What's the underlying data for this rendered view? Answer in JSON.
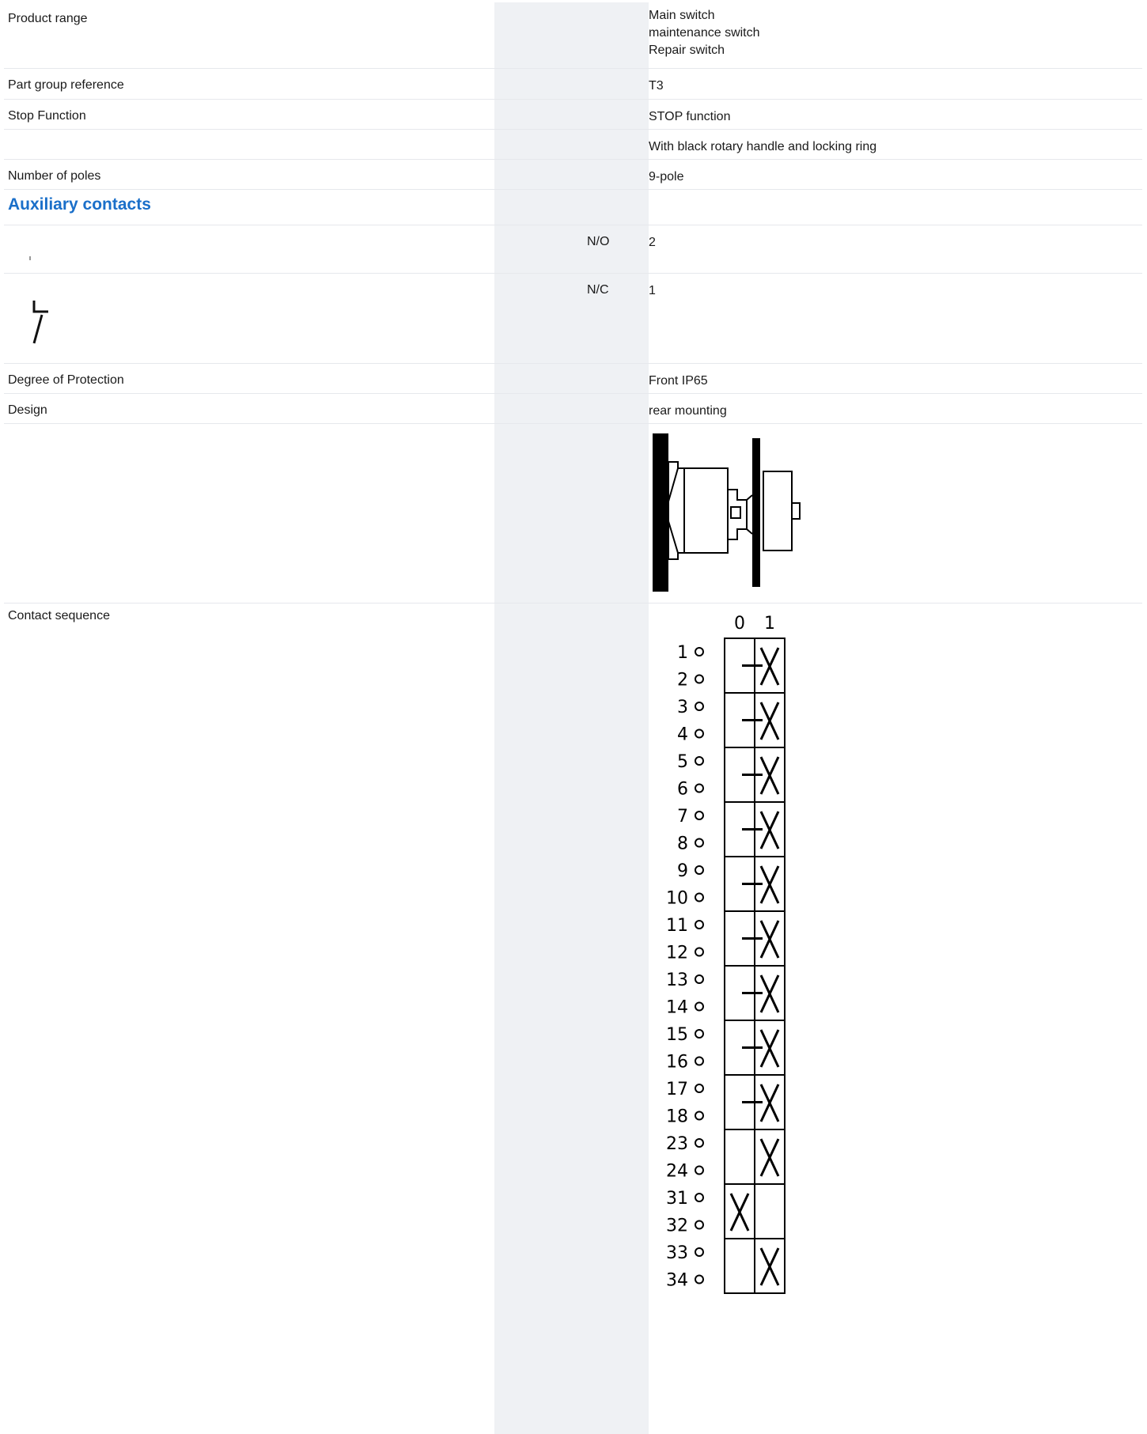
{
  "rows": [
    {
      "label": "Product range",
      "value": "Main switch\nmaintenance switch\nRepair switch"
    },
    {
      "label": "Part group reference",
      "value": "T3"
    },
    {
      "label": "Stop Function",
      "value": "STOP function"
    },
    {
      "label": "",
      "value": "With black rotary handle and locking ring"
    },
    {
      "label": "Number of poles",
      "value": "9-pole"
    }
  ],
  "section_title": "Auxiliary contacts",
  "aux": [
    {
      "unit": "N/O",
      "value": "2",
      "icon": "normally-open-contact-icon"
    },
    {
      "unit": "N/C",
      "value": "1",
      "icon": "normally-closed-contact-icon"
    }
  ],
  "rows2": [
    {
      "label": "Degree of Protection",
      "value": "Front IP65"
    },
    {
      "label": "Design",
      "value": "rear mounting"
    }
  ],
  "contact_label": "Contact sequence",
  "contact_sequence": {
    "positions": [
      "0",
      "1"
    ],
    "pairs": [
      {
        "terminals": [
          "1",
          "2"
        ],
        "pos0": false,
        "pos1": true,
        "early": true
      },
      {
        "terminals": [
          "3",
          "4"
        ],
        "pos0": false,
        "pos1": true,
        "early": true
      },
      {
        "terminals": [
          "5",
          "6"
        ],
        "pos0": false,
        "pos1": true,
        "early": true
      },
      {
        "terminals": [
          "7",
          "8"
        ],
        "pos0": false,
        "pos1": true,
        "early": true
      },
      {
        "terminals": [
          "9",
          "10"
        ],
        "pos0": false,
        "pos1": true,
        "early": true
      },
      {
        "terminals": [
          "11",
          "12"
        ],
        "pos0": false,
        "pos1": true,
        "early": true
      },
      {
        "terminals": [
          "13",
          "14"
        ],
        "pos0": false,
        "pos1": true,
        "early": true
      },
      {
        "terminals": [
          "15",
          "16"
        ],
        "pos0": false,
        "pos1": true,
        "early": true
      },
      {
        "terminals": [
          "17",
          "18"
        ],
        "pos0": false,
        "pos1": true,
        "early": true
      },
      {
        "terminals": [
          "23",
          "24"
        ],
        "pos0": false,
        "pos1": true,
        "early": false
      },
      {
        "terminals": [
          "31",
          "32"
        ],
        "pos0": true,
        "pos1": false,
        "early": false
      },
      {
        "terminals": [
          "33",
          "34"
        ],
        "pos0": false,
        "pos1": true,
        "early": false
      }
    ]
  }
}
